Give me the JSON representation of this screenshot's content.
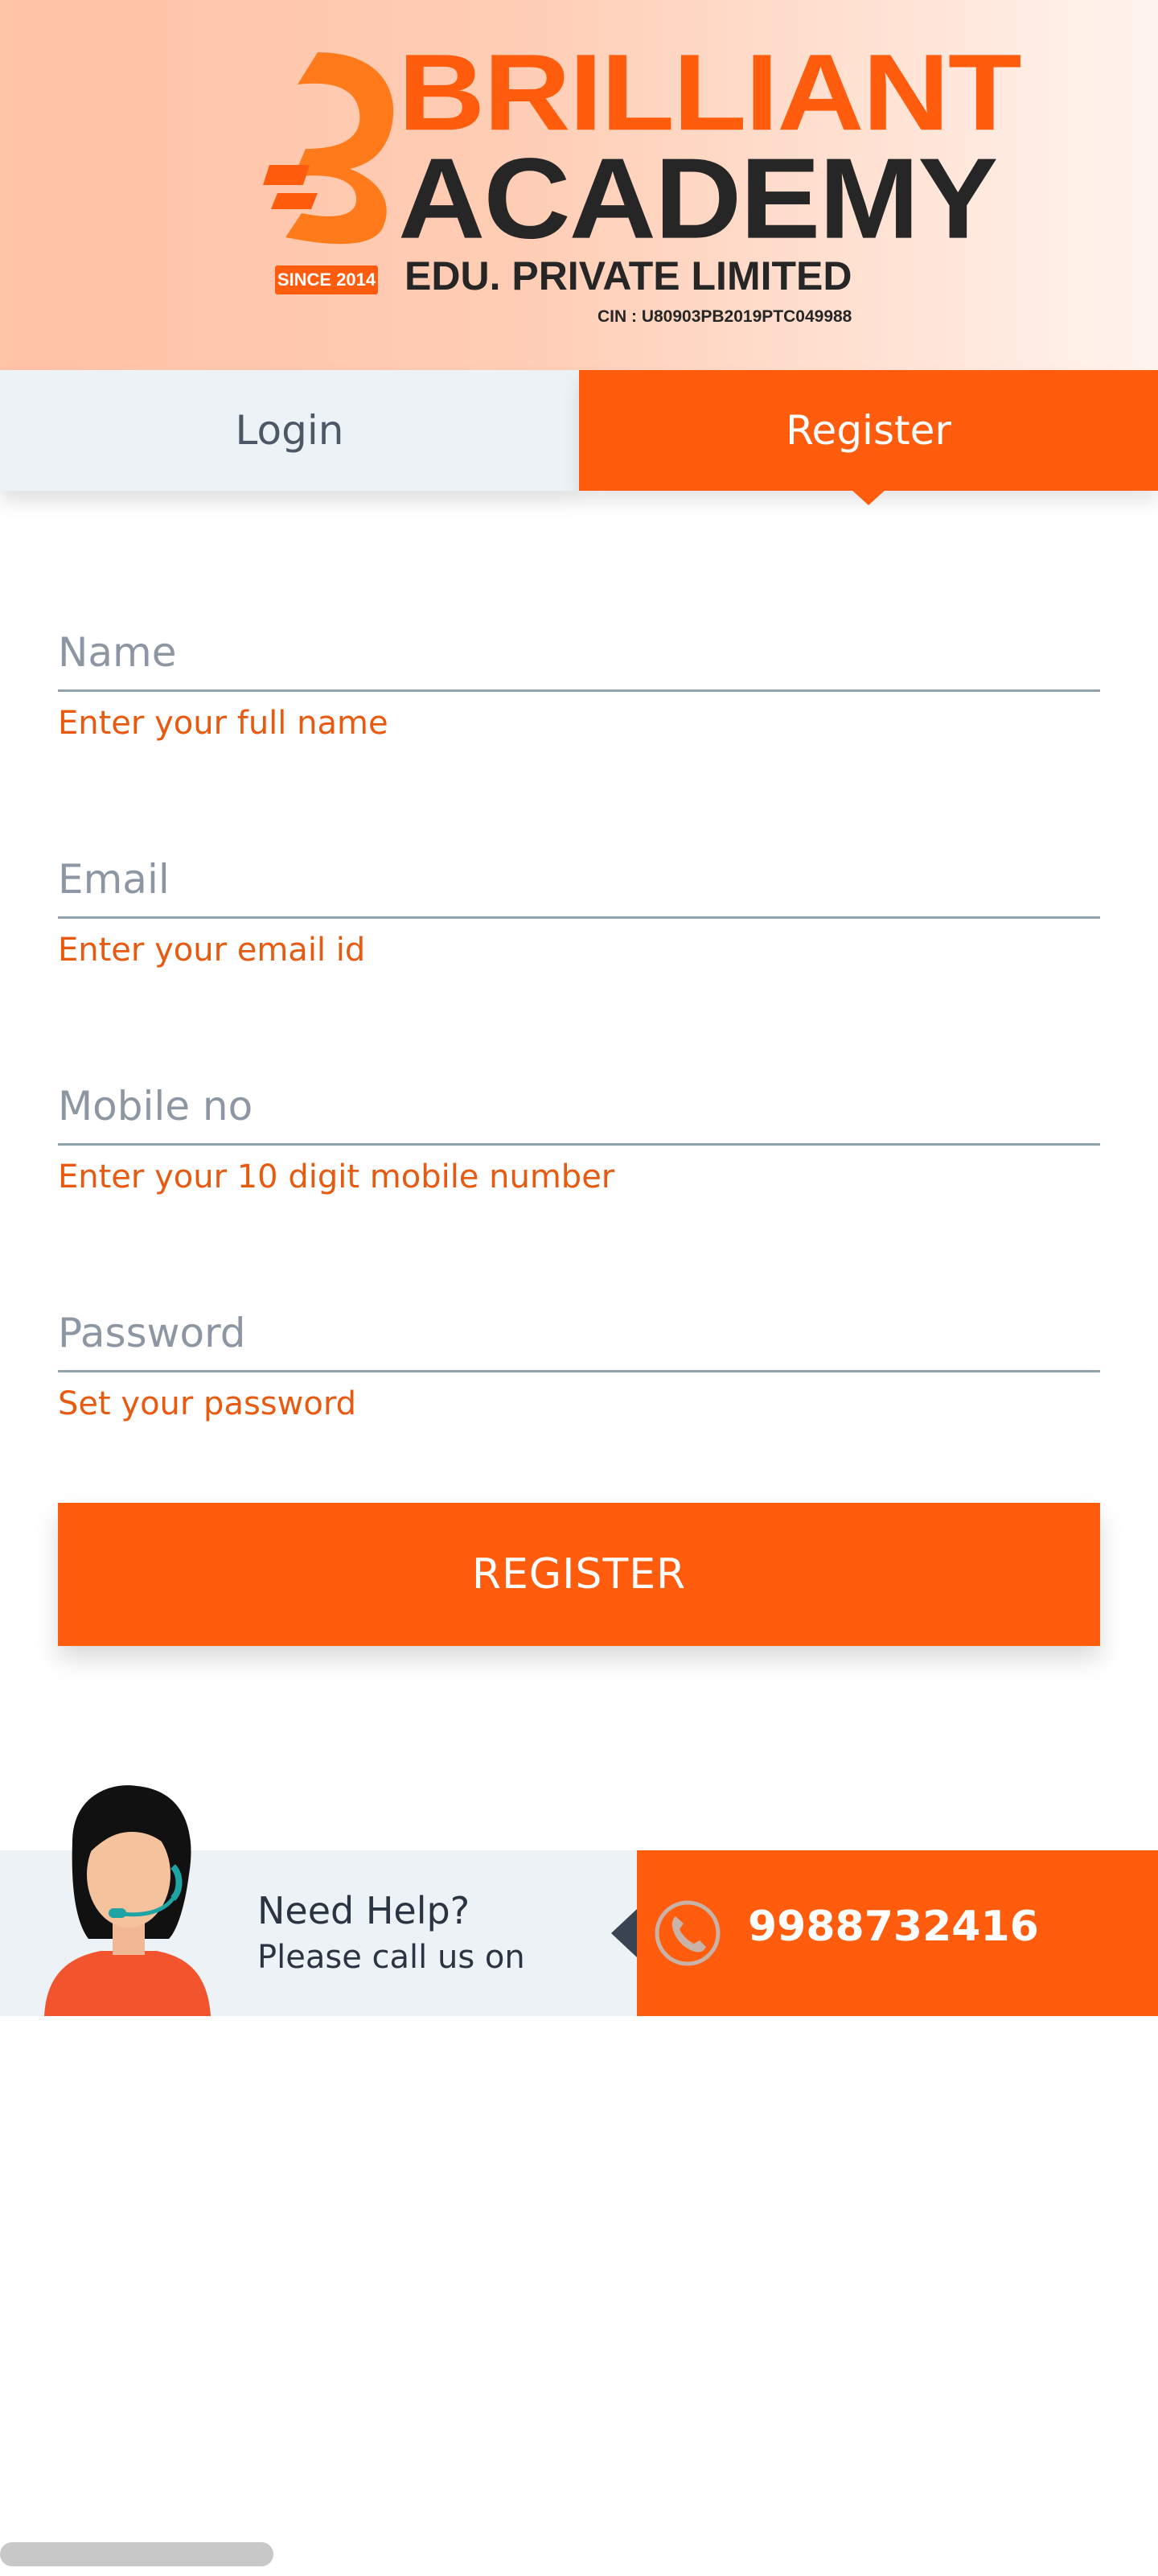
{
  "header": {
    "logo": {
      "line1": "BRILLIANT",
      "line2": "ACADEMY",
      "since_badge": "SINCE 2014",
      "subtitle": "EDU. PRIVATE LIMITED",
      "cin": "CIN : U80903PB2019PTC049988"
    }
  },
  "tabs": [
    {
      "label": "Login",
      "active": false
    },
    {
      "label": "Register",
      "active": true
    }
  ],
  "form": {
    "name": {
      "placeholder": "Name",
      "value": "",
      "hint": "Enter your full name"
    },
    "email": {
      "placeholder": "Email",
      "value": "",
      "hint": "Enter your email id"
    },
    "mobile": {
      "placeholder": "Mobile no",
      "value": "",
      "hint": "Enter your 10 digit mobile number"
    },
    "password": {
      "placeholder": "Password",
      "value": "",
      "hint": "Set your password"
    },
    "submit_label": "REGISTER"
  },
  "help": {
    "title": "Need Help?",
    "subtitle": "Please call us on",
    "phone": "9988732416",
    "icon": "phone-icon"
  },
  "colors": {
    "accent": "#ff5c0e",
    "tab_inactive_bg": "#ecf2f5",
    "hint": "#e85a10",
    "text_dark": "#2b3442"
  }
}
